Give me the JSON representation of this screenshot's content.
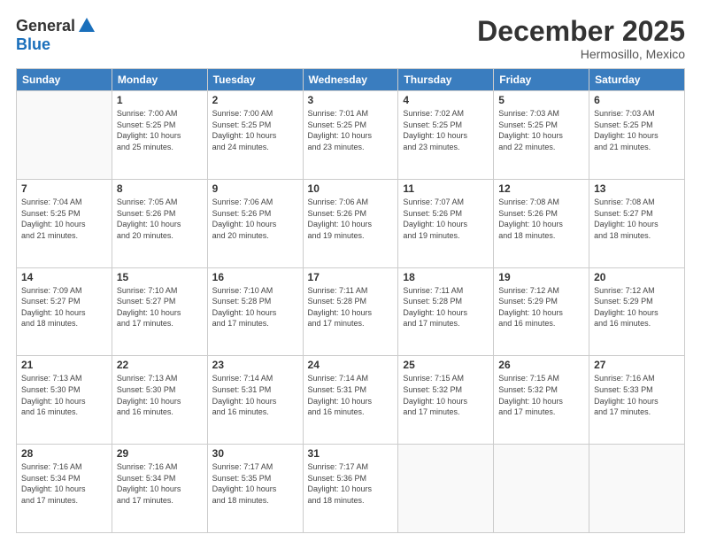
{
  "logo": {
    "general": "General",
    "blue": "Blue"
  },
  "header": {
    "month": "December 2025",
    "location": "Hermosillo, Mexico"
  },
  "weekdays": [
    "Sunday",
    "Monday",
    "Tuesday",
    "Wednesday",
    "Thursday",
    "Friday",
    "Saturday"
  ],
  "weeks": [
    [
      {
        "day": "",
        "info": ""
      },
      {
        "day": "1",
        "info": "Sunrise: 7:00 AM\nSunset: 5:25 PM\nDaylight: 10 hours\nand 25 minutes."
      },
      {
        "day": "2",
        "info": "Sunrise: 7:00 AM\nSunset: 5:25 PM\nDaylight: 10 hours\nand 24 minutes."
      },
      {
        "day": "3",
        "info": "Sunrise: 7:01 AM\nSunset: 5:25 PM\nDaylight: 10 hours\nand 23 minutes."
      },
      {
        "day": "4",
        "info": "Sunrise: 7:02 AM\nSunset: 5:25 PM\nDaylight: 10 hours\nand 23 minutes."
      },
      {
        "day": "5",
        "info": "Sunrise: 7:03 AM\nSunset: 5:25 PM\nDaylight: 10 hours\nand 22 minutes."
      },
      {
        "day": "6",
        "info": "Sunrise: 7:03 AM\nSunset: 5:25 PM\nDaylight: 10 hours\nand 21 minutes."
      }
    ],
    [
      {
        "day": "7",
        "info": "Sunrise: 7:04 AM\nSunset: 5:25 PM\nDaylight: 10 hours\nand 21 minutes."
      },
      {
        "day": "8",
        "info": "Sunrise: 7:05 AM\nSunset: 5:26 PM\nDaylight: 10 hours\nand 20 minutes."
      },
      {
        "day": "9",
        "info": "Sunrise: 7:06 AM\nSunset: 5:26 PM\nDaylight: 10 hours\nand 20 minutes."
      },
      {
        "day": "10",
        "info": "Sunrise: 7:06 AM\nSunset: 5:26 PM\nDaylight: 10 hours\nand 19 minutes."
      },
      {
        "day": "11",
        "info": "Sunrise: 7:07 AM\nSunset: 5:26 PM\nDaylight: 10 hours\nand 19 minutes."
      },
      {
        "day": "12",
        "info": "Sunrise: 7:08 AM\nSunset: 5:26 PM\nDaylight: 10 hours\nand 18 minutes."
      },
      {
        "day": "13",
        "info": "Sunrise: 7:08 AM\nSunset: 5:27 PM\nDaylight: 10 hours\nand 18 minutes."
      }
    ],
    [
      {
        "day": "14",
        "info": "Sunrise: 7:09 AM\nSunset: 5:27 PM\nDaylight: 10 hours\nand 18 minutes."
      },
      {
        "day": "15",
        "info": "Sunrise: 7:10 AM\nSunset: 5:27 PM\nDaylight: 10 hours\nand 17 minutes."
      },
      {
        "day": "16",
        "info": "Sunrise: 7:10 AM\nSunset: 5:28 PM\nDaylight: 10 hours\nand 17 minutes."
      },
      {
        "day": "17",
        "info": "Sunrise: 7:11 AM\nSunset: 5:28 PM\nDaylight: 10 hours\nand 17 minutes."
      },
      {
        "day": "18",
        "info": "Sunrise: 7:11 AM\nSunset: 5:28 PM\nDaylight: 10 hours\nand 17 minutes."
      },
      {
        "day": "19",
        "info": "Sunrise: 7:12 AM\nSunset: 5:29 PM\nDaylight: 10 hours\nand 16 minutes."
      },
      {
        "day": "20",
        "info": "Sunrise: 7:12 AM\nSunset: 5:29 PM\nDaylight: 10 hours\nand 16 minutes."
      }
    ],
    [
      {
        "day": "21",
        "info": "Sunrise: 7:13 AM\nSunset: 5:30 PM\nDaylight: 10 hours\nand 16 minutes."
      },
      {
        "day": "22",
        "info": "Sunrise: 7:13 AM\nSunset: 5:30 PM\nDaylight: 10 hours\nand 16 minutes."
      },
      {
        "day": "23",
        "info": "Sunrise: 7:14 AM\nSunset: 5:31 PM\nDaylight: 10 hours\nand 16 minutes."
      },
      {
        "day": "24",
        "info": "Sunrise: 7:14 AM\nSunset: 5:31 PM\nDaylight: 10 hours\nand 16 minutes."
      },
      {
        "day": "25",
        "info": "Sunrise: 7:15 AM\nSunset: 5:32 PM\nDaylight: 10 hours\nand 17 minutes."
      },
      {
        "day": "26",
        "info": "Sunrise: 7:15 AM\nSunset: 5:32 PM\nDaylight: 10 hours\nand 17 minutes."
      },
      {
        "day": "27",
        "info": "Sunrise: 7:16 AM\nSunset: 5:33 PM\nDaylight: 10 hours\nand 17 minutes."
      }
    ],
    [
      {
        "day": "28",
        "info": "Sunrise: 7:16 AM\nSunset: 5:34 PM\nDaylight: 10 hours\nand 17 minutes."
      },
      {
        "day": "29",
        "info": "Sunrise: 7:16 AM\nSunset: 5:34 PM\nDaylight: 10 hours\nand 17 minutes."
      },
      {
        "day": "30",
        "info": "Sunrise: 7:17 AM\nSunset: 5:35 PM\nDaylight: 10 hours\nand 18 minutes."
      },
      {
        "day": "31",
        "info": "Sunrise: 7:17 AM\nSunset: 5:36 PM\nDaylight: 10 hours\nand 18 minutes."
      },
      {
        "day": "",
        "info": ""
      },
      {
        "day": "",
        "info": ""
      },
      {
        "day": "",
        "info": ""
      }
    ]
  ]
}
